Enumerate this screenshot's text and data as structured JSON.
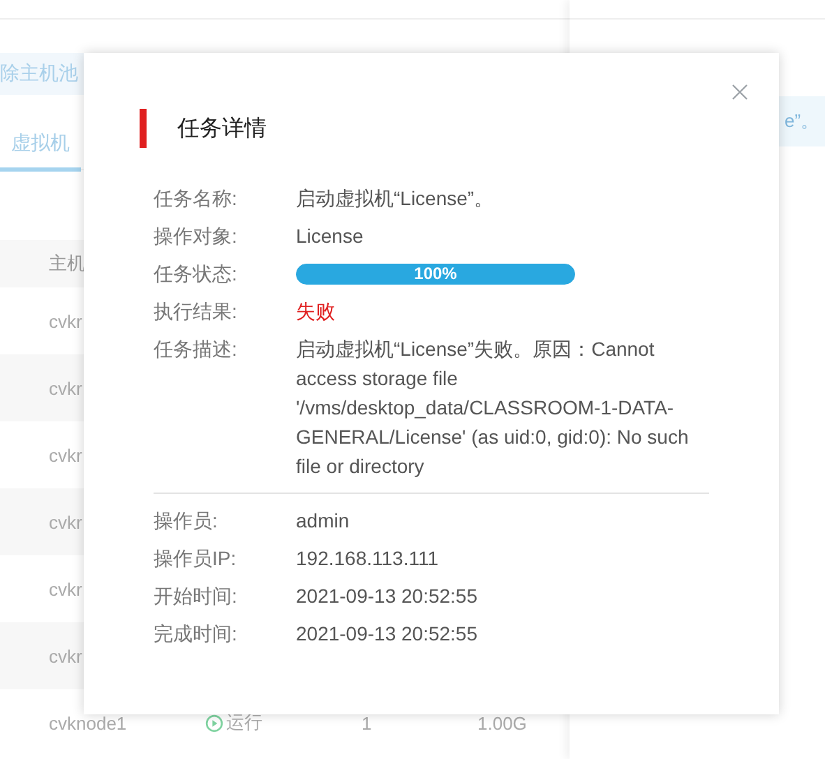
{
  "background": {
    "toolbar_button": "除主机池",
    "tab": {
      "label": "虚拟机",
      "selected": true
    },
    "notice": "e”。",
    "table": {
      "header": "主机",
      "rows": [
        {
          "host": "cvkr"
        },
        {
          "host": "cvkr"
        },
        {
          "host": "cvkr"
        },
        {
          "host": "cvkr"
        },
        {
          "host": "cvkr"
        },
        {
          "host": "cvkr"
        },
        {
          "host": "cvknode1",
          "status": "运行",
          "count": "1",
          "memory": "1.00G"
        }
      ]
    }
  },
  "dialog": {
    "title": "任务详情",
    "fields": [
      {
        "kind": "text",
        "label": "任务名称:",
        "value": "启动虚拟机“License”。"
      },
      {
        "kind": "text",
        "label": "操作对象:",
        "value": "License"
      },
      {
        "kind": "progress",
        "label": "任务状态:",
        "value": "100%",
        "level": 1
      },
      {
        "kind": "failure",
        "label": "执行结果:",
        "value": "失败"
      },
      {
        "kind": "text",
        "label": "任务描述:",
        "value": "启动虚拟机“License”失败。原因：Cannot access storage file '/vms/desktop_data/CLASSROOM-1-DATA-GENERAL/License' (as uid:0, gid:0): No such file or directory"
      }
    ],
    "meta": [
      {
        "label": "操作员:",
        "value": "admin"
      },
      {
        "label": "操作员IP:",
        "value": "192.168.113.111"
      },
      {
        "label": "开始时间:",
        "value": "2021-09-13 20:52:55"
      },
      {
        "label": "完成时间:",
        "value": "2021-09-13 20:52:55"
      }
    ]
  }
}
